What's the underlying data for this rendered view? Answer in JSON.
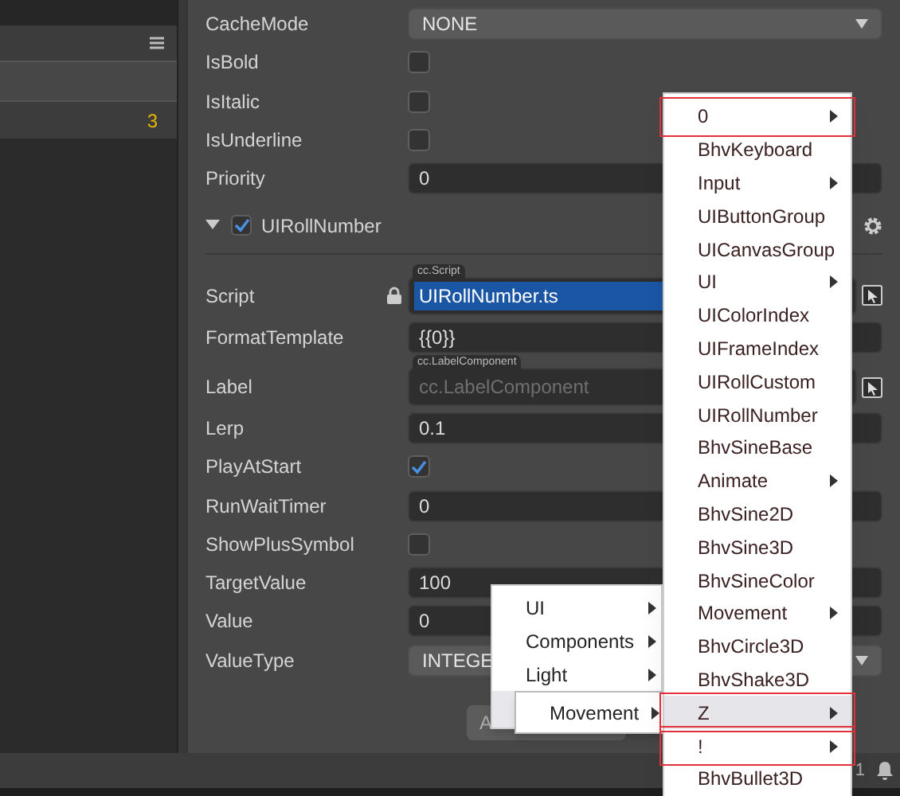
{
  "hierarchy": {
    "row_count": "3"
  },
  "properties": [
    {
      "kind": "select",
      "label": "CacheMode",
      "value": "NONE"
    },
    {
      "kind": "checkbox",
      "label": "IsBold",
      "checked": false
    },
    {
      "kind": "checkbox",
      "label": "IsItalic",
      "checked": false
    },
    {
      "kind": "checkbox",
      "label": "IsUnderline",
      "checked": false
    },
    {
      "kind": "input",
      "label": "Priority",
      "value": "0"
    }
  ],
  "component": {
    "title": "UIRollNumber",
    "enabled": true,
    "expanded": true,
    "properties": [
      {
        "kind": "asset",
        "label": "Script",
        "tag": "cc.Script",
        "value": "UIRollNumber.ts",
        "locked": true
      },
      {
        "kind": "input",
        "label": "FormatTemplate",
        "value": "{{0}}"
      },
      {
        "kind": "asset",
        "label": "Label",
        "tag": "cc.LabelComponent",
        "placeholder": "cc.LabelComponent",
        "locked": false
      },
      {
        "kind": "input",
        "label": "Lerp",
        "value": "0.1"
      },
      {
        "kind": "checkbox",
        "label": "PlayAtStart",
        "checked": true
      },
      {
        "kind": "input",
        "label": "RunWaitTimer",
        "value": "0"
      },
      {
        "kind": "checkbox",
        "label": "ShowPlusSymbol",
        "checked": false
      },
      {
        "kind": "input",
        "label": "TargetValue",
        "value": "100"
      },
      {
        "kind": "input",
        "label": "Value",
        "value": "0"
      },
      {
        "kind": "select",
        "label": "ValueType",
        "value": "INTEGE"
      }
    ],
    "add_button": "A"
  },
  "status_bar": {
    "count": "1"
  },
  "context_menu": [
    {
      "label": "UI",
      "submenu": true,
      "selected": false
    },
    {
      "label": "Components",
      "submenu": true,
      "selected": false
    },
    {
      "label": "Light",
      "submenu": true,
      "selected": false
    },
    {
      "label": "Movement",
      "submenu": true,
      "selected": true
    }
  ],
  "main_menu": [
    {
      "label": "0",
      "submenu": true,
      "selected": false,
      "boxed": true
    },
    {
      "label": "BhvKeyboard",
      "submenu": false,
      "selected": false,
      "boxed": false
    },
    {
      "label": "Input",
      "submenu": true,
      "selected": false,
      "boxed": false
    },
    {
      "label": "UIButtonGroup",
      "submenu": false,
      "selected": false,
      "boxed": false
    },
    {
      "label": "UICanvasGroup",
      "submenu": false,
      "selected": false,
      "boxed": false
    },
    {
      "label": "UI",
      "submenu": true,
      "selected": false,
      "boxed": false
    },
    {
      "label": "UIColorIndex",
      "submenu": false,
      "selected": false,
      "boxed": false
    },
    {
      "label": "UIFrameIndex",
      "submenu": false,
      "selected": false,
      "boxed": false
    },
    {
      "label": "UIRollCustom",
      "submenu": false,
      "selected": false,
      "boxed": false
    },
    {
      "label": "UIRollNumber",
      "submenu": false,
      "selected": false,
      "boxed": false
    },
    {
      "label": "BhvSineBase",
      "submenu": false,
      "selected": false,
      "boxed": false
    },
    {
      "label": "Animate",
      "submenu": true,
      "selected": false,
      "boxed": false
    },
    {
      "label": "BhvSine2D",
      "submenu": false,
      "selected": false,
      "boxed": false
    },
    {
      "label": "BhvSine3D",
      "submenu": false,
      "selected": false,
      "boxed": false
    },
    {
      "label": "BhvSineColor",
      "submenu": false,
      "selected": false,
      "boxed": false
    },
    {
      "label": "Movement",
      "submenu": true,
      "selected": false,
      "boxed": false
    },
    {
      "label": "BhvCircle3D",
      "submenu": false,
      "selected": false,
      "boxed": false
    },
    {
      "label": "BhvShake3D",
      "submenu": false,
      "selected": false,
      "boxed": false
    },
    {
      "label": "Z",
      "submenu": true,
      "selected": true,
      "boxed": true
    },
    {
      "label": "!",
      "submenu": true,
      "selected": false,
      "boxed": true
    },
    {
      "label": "BhvBullet3D",
      "submenu": false,
      "selected": false,
      "boxed": false
    }
  ]
}
